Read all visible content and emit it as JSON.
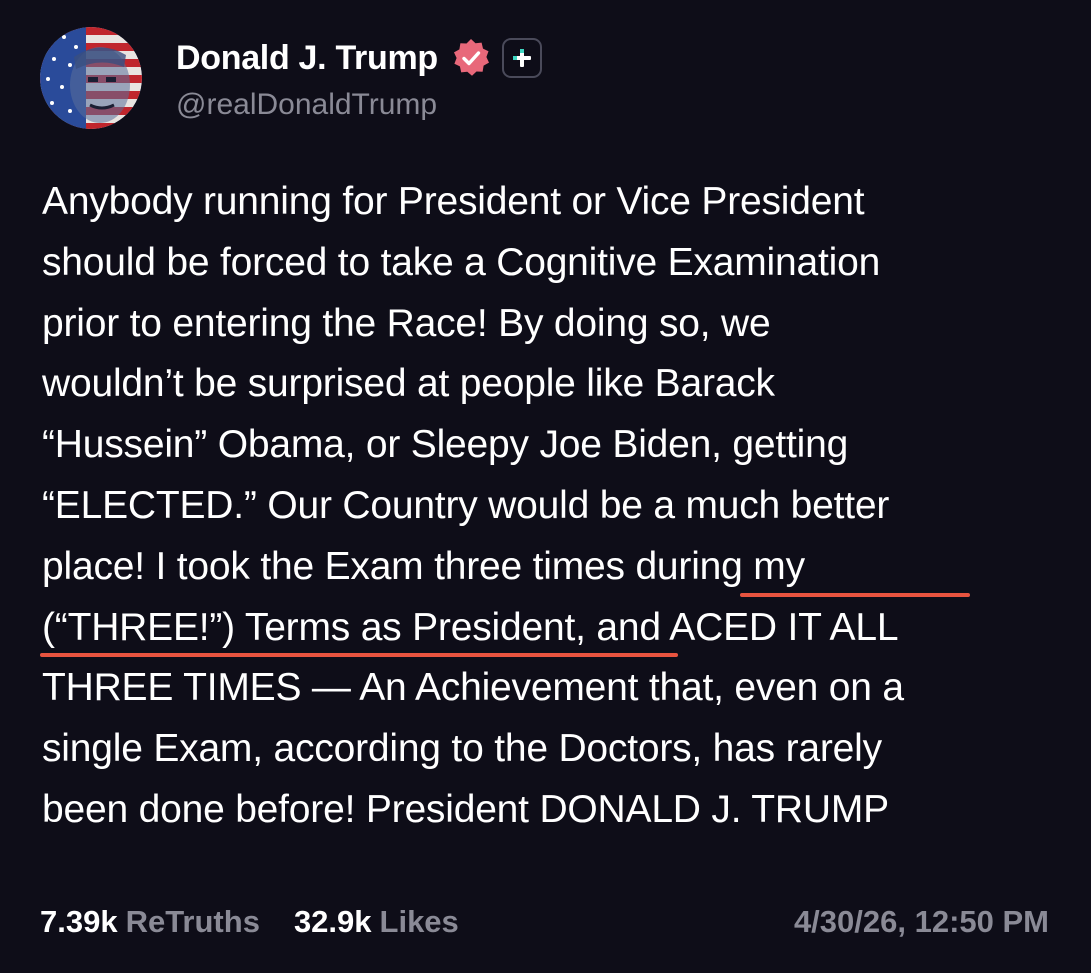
{
  "colors": {
    "background": "#0e0d18",
    "text": "#ffffff",
    "muted": "#8a8a96",
    "verified_badge": "#e8687a",
    "underline": "#e8533f"
  },
  "author": {
    "display_name": "Donald J. Trump",
    "handle": "@realDonaldTrump",
    "avatar_icon": "flag-portrait-avatar",
    "verified_icon": "verified-badge-icon",
    "action_icon": "plus-icon"
  },
  "post": {
    "lines": [
      "Anybody running for President or Vice President",
      "should be forced to take a Cognitive Examination",
      "prior to entering the Race! By doing so, we",
      "wouldn’t be surprised at people like Barack",
      "“Hussein” Obama, or Sleepy Joe Biden, getting",
      "“ELECTED.” Our Country would be a much better",
      "place! I took the Exam three times during my",
      "(“THREE!”) Terms as President, and ACED IT ALL",
      "THREE TIMES — An Achievement that, even on a",
      "single Exam, according to the Doctors, has rarely",
      "been done before! President DONALD J. TRUMP"
    ]
  },
  "stats": {
    "retruths_count": "7.39k",
    "retruths_label": "ReTruths",
    "likes_count": "32.9k",
    "likes_label": "Likes"
  },
  "timestamp": "4/30/26, 12:50 PM"
}
